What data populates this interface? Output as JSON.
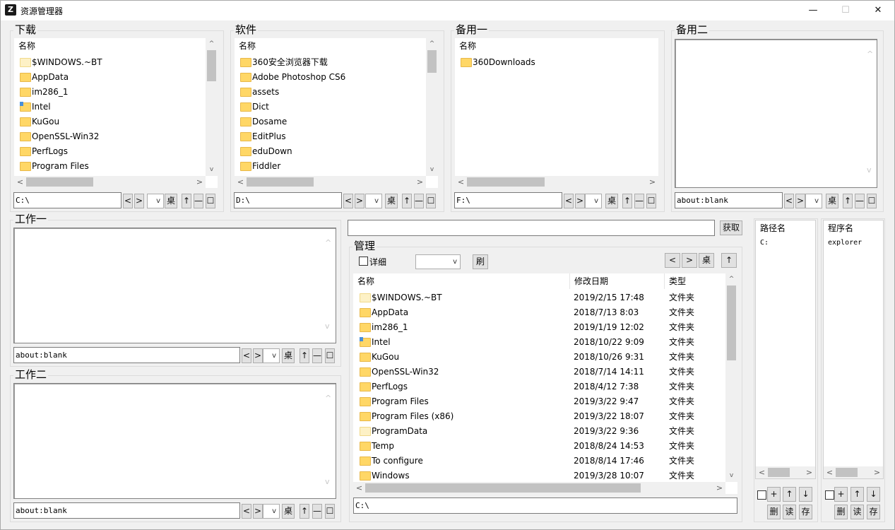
{
  "window": {
    "title": "资源管理器",
    "app_icon": "Z"
  },
  "glyphs": {
    "back": "<",
    "forward": ">",
    "up": "↑",
    "min": "—",
    "max": "☐",
    "sort": "^",
    "scroll_up": "^",
    "scroll_down": "v",
    "dropdown": "v",
    "minimize": "—",
    "maximize": "☐",
    "close": "✕"
  },
  "panels": [
    {
      "title": "下载",
      "header": "名称",
      "path": "C:\\",
      "desktop": "桌",
      "items": [
        {
          "name": "$WINDOWS.~BT",
          "icon": "folder-light-icon"
        },
        {
          "name": "AppData",
          "icon": "folder-icon"
        },
        {
          "name": "im286_1",
          "icon": "folder-icon"
        },
        {
          "name": "Intel",
          "icon": "folder-shortcut-icon"
        },
        {
          "name": "KuGou",
          "icon": "folder-icon"
        },
        {
          "name": "OpenSSL-Win32",
          "icon": "folder-icon"
        },
        {
          "name": "PerfLogs",
          "icon": "folder-icon"
        },
        {
          "name": "Program Files",
          "icon": "folder-icon"
        }
      ]
    },
    {
      "title": "软件",
      "header": "名称",
      "path": "D:\\",
      "desktop": "桌",
      "items": [
        {
          "name": "360安全浏览器下载",
          "icon": "folder-icon"
        },
        {
          "name": "Adobe Photoshop CS6",
          "icon": "folder-icon"
        },
        {
          "name": "assets",
          "icon": "folder-icon"
        },
        {
          "name": "Dict",
          "icon": "folder-icon"
        },
        {
          "name": "Dosame",
          "icon": "folder-icon"
        },
        {
          "name": "EditPlus",
          "icon": "folder-icon"
        },
        {
          "name": "eduDown",
          "icon": "folder-icon"
        },
        {
          "name": "Fiddler",
          "icon": "folder-icon"
        }
      ]
    },
    {
      "title": "备用一",
      "header": "名称",
      "path": "F:\\",
      "desktop": "桌",
      "items": [
        {
          "name": "360Downloads",
          "icon": "folder-icon"
        }
      ]
    },
    {
      "title": "备用二",
      "path": "about:blank",
      "desktop": "桌"
    }
  ],
  "work": [
    {
      "title": "工作一",
      "path": "about:blank",
      "desktop": "桌"
    },
    {
      "title": "工作二",
      "path": "about:blank",
      "desktop": "桌"
    }
  ],
  "manage": {
    "fetch_label": "获取",
    "title": "管理",
    "detail_label": "详细",
    "refresh_label": "刷",
    "desktop": "桌",
    "columns": [
      "名称",
      "修改日期",
      "类型"
    ],
    "rows": [
      {
        "name": "$WINDOWS.~BT",
        "date": "2019/2/15 17:48",
        "type": "文件夹",
        "icon": "folder-light-icon"
      },
      {
        "name": "AppData",
        "date": "2018/7/13 8:03",
        "type": "文件夹",
        "icon": "folder-icon"
      },
      {
        "name": "im286_1",
        "date": "2019/1/19 12:02",
        "type": "文件夹",
        "icon": "folder-icon"
      },
      {
        "name": "Intel",
        "date": "2018/10/22 9:09",
        "type": "文件夹",
        "icon": "folder-shortcut-icon"
      },
      {
        "name": "KuGou",
        "date": "2018/10/26 9:31",
        "type": "文件夹",
        "icon": "folder-icon"
      },
      {
        "name": "OpenSSL-Win32",
        "date": "2018/7/14 14:11",
        "type": "文件夹",
        "icon": "folder-icon"
      },
      {
        "name": "PerfLogs",
        "date": "2018/4/12 7:38",
        "type": "文件夹",
        "icon": "folder-icon"
      },
      {
        "name": "Program Files",
        "date": "2019/3/22 9:47",
        "type": "文件夹",
        "icon": "folder-icon"
      },
      {
        "name": "Program Files (x86)",
        "date": "2019/3/22 18:07",
        "type": "文件夹",
        "icon": "folder-icon"
      },
      {
        "name": "ProgramData",
        "date": "2019/3/22 9:36",
        "type": "文件夹",
        "icon": "folder-light-icon"
      },
      {
        "name": "Temp",
        "date": "2018/8/24 14:53",
        "type": "文件夹",
        "icon": "folder-icon"
      },
      {
        "name": "To configure",
        "date": "2018/8/14 17:46",
        "type": "文件夹",
        "icon": "folder-icon"
      },
      {
        "name": "Windows",
        "date": "2019/3/28 10:07",
        "type": "文件夹",
        "icon": "folder-icon"
      }
    ],
    "path": "C:\\"
  },
  "path_list": {
    "header": "路径名",
    "items": [
      "C:"
    ]
  },
  "program_list": {
    "header": "程序名",
    "items": [
      "explorer"
    ]
  },
  "list_buttons": {
    "add": "+",
    "up": "↑",
    "down": "↓",
    "delete": "删",
    "read": "读",
    "save": "存"
  }
}
